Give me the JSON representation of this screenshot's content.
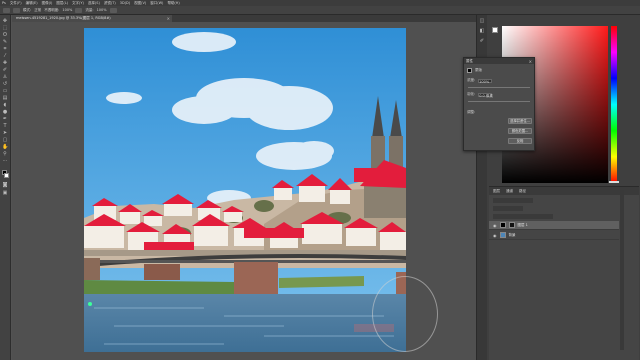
{
  "menubar": {
    "items": [
      "Ps",
      "文件(F)",
      "编辑(E)",
      "图像(I)",
      "图层(L)",
      "文字(Y)",
      "选择(S)",
      "滤镜(T)",
      "3D(D)",
      "视图(V)",
      "窗口(W)",
      "帮助(H)"
    ]
  },
  "options": {
    "mode_label": "模式:",
    "mode_value": "正常",
    "opacity_label": "不透明度:",
    "opacity_value": "100%",
    "flow_label": "流量:",
    "flow_value": "100%"
  },
  "document": {
    "tab_title": "meissen-4519281_1920.jpg @ 33.3%(图层 1, RGB/8#)",
    "close_glyph": "×"
  },
  "popup": {
    "title": "属性",
    "close_glyph": "×",
    "mask_label": "蒙版",
    "density_label": "浓度:",
    "density_value": "100%",
    "feather_label": "羽化:",
    "feather_value": "0.0 像素",
    "refine_label": "调整:",
    "btn_select_mask": "选择并遮住...",
    "btn_color_range": "颜色范围...",
    "btn_invert": "反相"
  },
  "layers": {
    "tabs": [
      "图层",
      "通道",
      "路径"
    ],
    "rows": [
      {
        "name": "图层 1",
        "selected": true
      },
      {
        "name": "背景",
        "selected": false
      }
    ]
  },
  "colors": {
    "accent_green": "#3cff9a",
    "picker_red": "#ff1a1a"
  }
}
